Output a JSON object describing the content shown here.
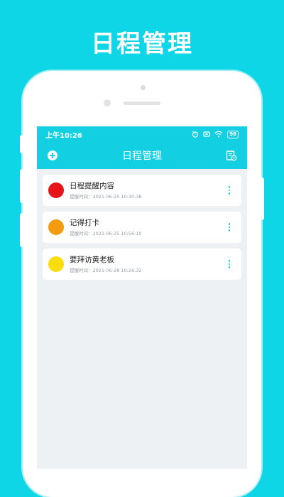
{
  "promo": {
    "title": "日程管理"
  },
  "status_bar": {
    "time": "上午10:26",
    "battery": "98"
  },
  "app_bar": {
    "title": "日程管理",
    "add_icon": "plus-circle-icon",
    "calendar_icon": "calendar-settings-icon"
  },
  "schedules": [
    {
      "title": "日程提醒内容",
      "time": "提醒时间：2021-06-25 10:30:38",
      "color": "#e8141b"
    },
    {
      "title": "记得打卡",
      "time": "提醒时间：2021-06-25 10:56:10",
      "color": "#f39c12"
    },
    {
      "title": "要拜访黄老板",
      "time": "提醒时间：2021-06-28 10:26:32",
      "color": "#f9dd0e"
    }
  ],
  "colors": {
    "accent": "#12d0e2",
    "background": "#0fd6e6",
    "list_bg": "#eef1f3"
  }
}
